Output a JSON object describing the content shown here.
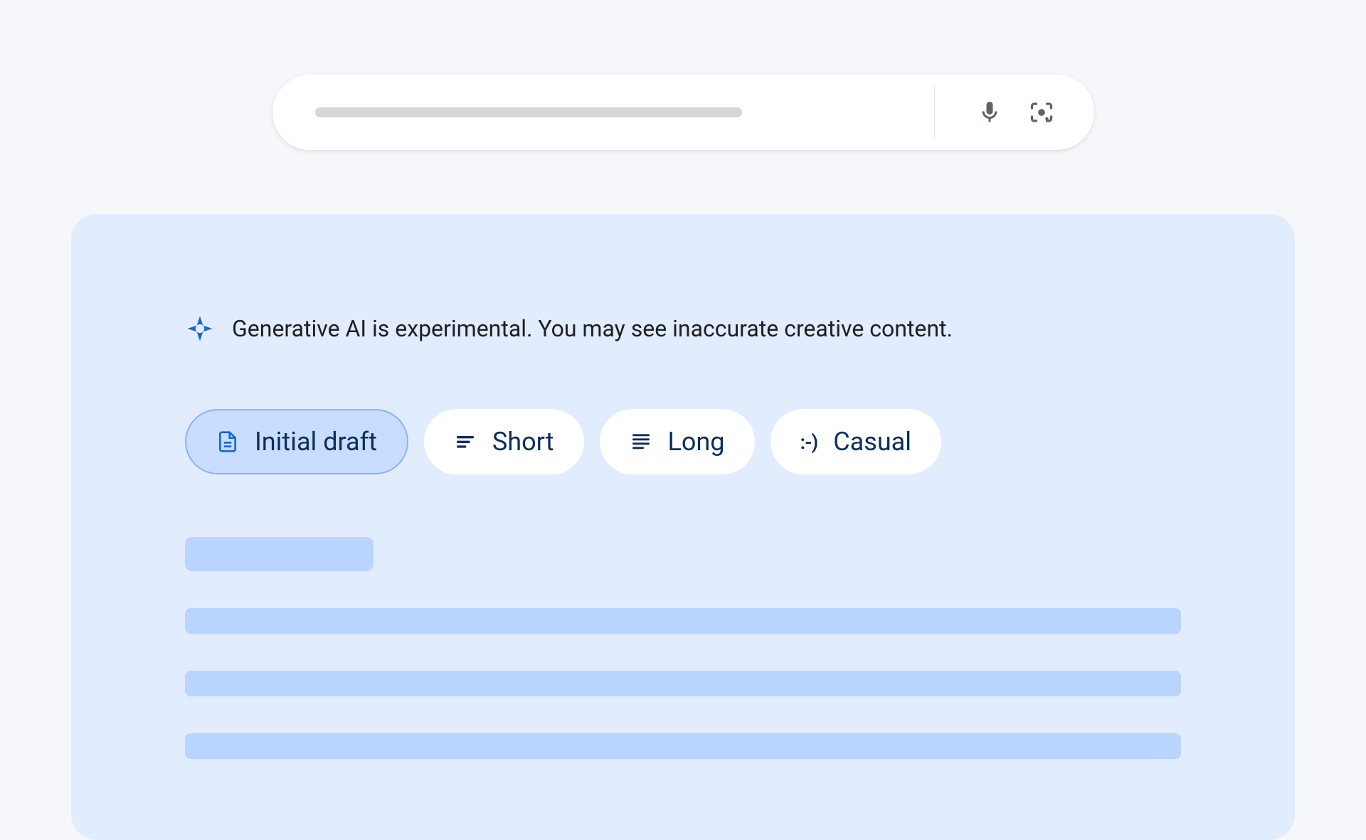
{
  "disclaimer": {
    "text": "Generative AI is experimental. You may see inaccurate creative content."
  },
  "chips": {
    "initial_draft": "Initial draft",
    "short": "Short",
    "long": "Long",
    "casual": "Casual"
  },
  "icons": {
    "mic": "mic-icon",
    "lens": "lens-icon",
    "sparkle": "sparkle-icon",
    "document": "document-icon",
    "short_lines": "short-lines-icon",
    "long_lines": "long-lines-icon",
    "casual": "casual-icon"
  },
  "colors": {
    "card_bg": "#e1ecff",
    "chip_selected_bg": "#c8ddff",
    "chip_selected_border": "#8bb4ee",
    "skeleton": "#b9d4ff",
    "text_primary": "#1f1f1f",
    "text_chip": "#0b2e5e",
    "sparkle": "#1967d2"
  }
}
